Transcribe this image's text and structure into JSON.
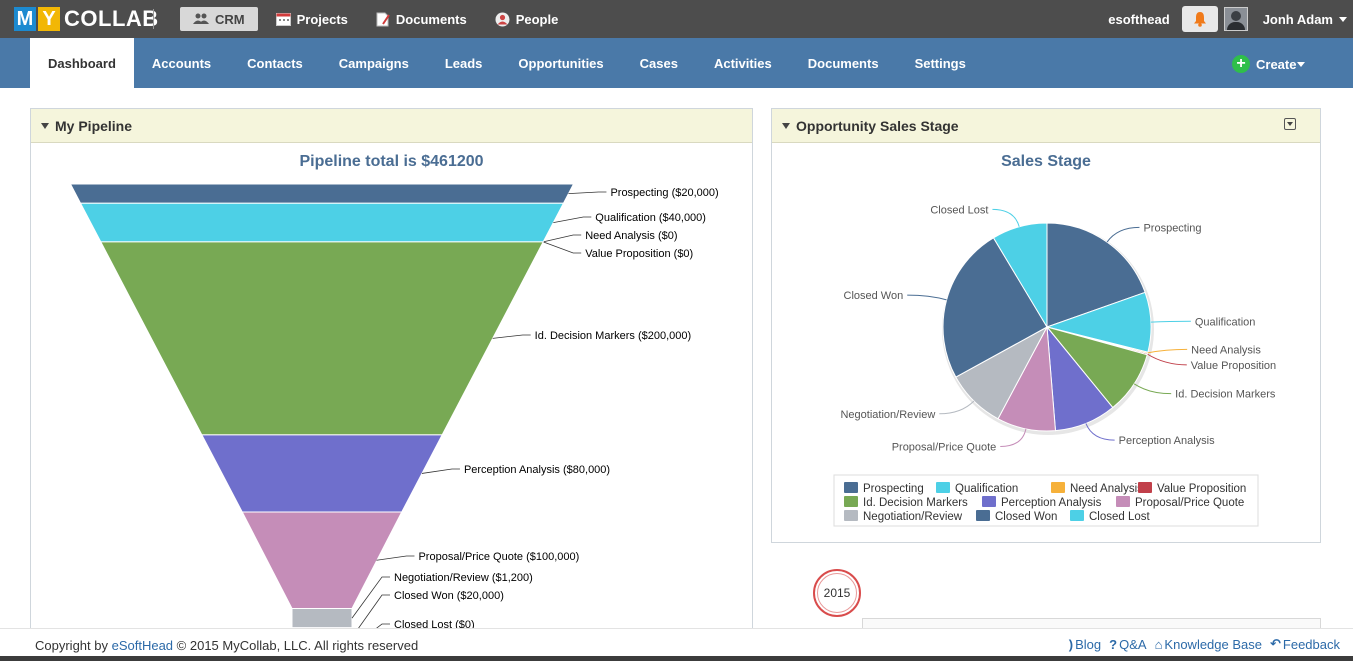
{
  "logo": {
    "m": "M",
    "y": "Y",
    "rest": "COLLAB"
  },
  "modules": [
    {
      "label": "CRM",
      "icon": "people-group-icon",
      "active": true
    },
    {
      "label": "Projects",
      "icon": "calendar-icon"
    },
    {
      "label": "Documents",
      "icon": "document-icon"
    },
    {
      "label": "People",
      "icon": "person-icon"
    }
  ],
  "account": {
    "name": "esofthead",
    "user": "Jonh Adam"
  },
  "tabs": [
    "Dashboard",
    "Accounts",
    "Contacts",
    "Campaigns",
    "Leads",
    "Opportunities",
    "Cases",
    "Activities",
    "Documents",
    "Settings"
  ],
  "create_label": "Create",
  "pipeline": {
    "panel_title": "My Pipeline",
    "chart_title": "Pipeline total is $461200"
  },
  "stage": {
    "panel_title": "Opportunity Sales Stage",
    "chart_title": "Sales Stage"
  },
  "chart_data": [
    {
      "type": "funnel",
      "title": "Pipeline total is $461200",
      "categories": [
        "Prospecting",
        "Qualification",
        "Need Analysis",
        "Value Proposition",
        "Id. Decision Markers",
        "Perception Analysis",
        "Proposal/Price Quote",
        "Negotiation/Review",
        "Closed Won",
        "Closed Lost"
      ],
      "values": [
        20000,
        40000,
        0,
        0,
        200000,
        80000,
        100000,
        1200,
        20000,
        0
      ],
      "labels": [
        "Prospecting ($20,000)",
        "Qualification ($40,000)",
        "Need Analysis ($0)",
        "Value Proposition ($0)",
        "Id. Decision Markers ($200,000)",
        "Perception Analysis ($80,000)",
        "Proposal/Price Quote ($100,000)",
        "Negotiation/Review ($1,200)",
        "Closed Won ($20,000)",
        "Closed Lost ($0)"
      ],
      "colors": [
        "#4a6d93",
        "#4dd0e6",
        "#f6b13a",
        "#c1404a",
        "#78a954",
        "#6f6fcc",
        "#c58db8",
        "#b5bac1",
        "#4a6d93",
        "#4dd0e6"
      ]
    },
    {
      "type": "pie",
      "title": "Sales Stage",
      "categories": [
        "Prospecting",
        "Qualification",
        "Need Analysis",
        "Value Proposition",
        "Id. Decision Markers",
        "Perception Analysis",
        "Proposal/Price Quote",
        "Negotiation/Review",
        "Closed Won",
        "Closed Lost"
      ],
      "values": [
        19.6,
        9.3,
        0.2,
        0.2,
        9.8,
        9.6,
        9.1,
        9.2,
        24.4,
        8.6
      ],
      "colors": [
        "#4a6d93",
        "#4dd0e6",
        "#f6b13a",
        "#c1404a",
        "#78a954",
        "#6f6fcc",
        "#c58db8",
        "#b5bac1",
        "#4a6d93",
        "#4dd0e6"
      ],
      "legend": "bottom"
    }
  ],
  "timeline": {
    "year": "2015"
  },
  "footer": {
    "copyright_prefix": "Copyright by",
    "company_link": "eSoftHead",
    "copyright_suffix": "© 2015 MyCollab, LLC. All rights reserved",
    "links": [
      {
        "label": "Blog",
        "icon": "rss-icon"
      },
      {
        "label": "Q&A",
        "icon": "question-icon"
      },
      {
        "label": "Knowledge Base",
        "icon": "bank-icon"
      },
      {
        "label": "Feedback",
        "icon": "reply-icon"
      }
    ]
  }
}
